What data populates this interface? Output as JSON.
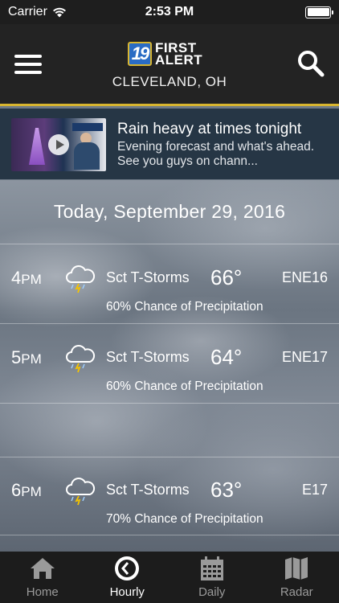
{
  "status_bar": {
    "carrier": "Carrier",
    "time": "2:53 PM"
  },
  "header": {
    "logo_number": "19",
    "logo_line1": "FIRST",
    "logo_line2": "ALERT",
    "city": "CLEVELAND, OH",
    "accent_color": "#d8b530"
  },
  "promo": {
    "title": "Rain heavy at times tonight",
    "subtitle": "Evening forecast and what's ahead.  See you guys on chann..."
  },
  "date_heading": "Today, September 29, 2016",
  "hours": [
    {
      "hour": "4",
      "ampm": "PM",
      "icon": "thunderstorm-cloud-icon",
      "condition": "Sct T-Storms",
      "temp": "66°",
      "wind": "ENE16",
      "precip": "60% Chance of Precipitation"
    },
    {
      "hour": "5",
      "ampm": "PM",
      "icon": "thunderstorm-cloud-icon",
      "condition": "Sct T-Storms",
      "temp": "64°",
      "wind": "ENE17",
      "precip": "60% Chance of Precipitation"
    },
    {
      "hour": "6",
      "ampm": "PM",
      "icon": "thunderstorm-cloud-icon",
      "condition": "Sct T-Storms",
      "temp": "63°",
      "wind": "E17",
      "precip": "70% Chance of Precipitation"
    }
  ],
  "tabs": [
    {
      "label": "Home",
      "icon": "home-icon",
      "active": false
    },
    {
      "label": "Hourly",
      "icon": "clock-icon",
      "active": true
    },
    {
      "label": "Daily",
      "icon": "calendar-icon",
      "active": false
    },
    {
      "label": "Radar",
      "icon": "map-icon",
      "active": false
    }
  ]
}
